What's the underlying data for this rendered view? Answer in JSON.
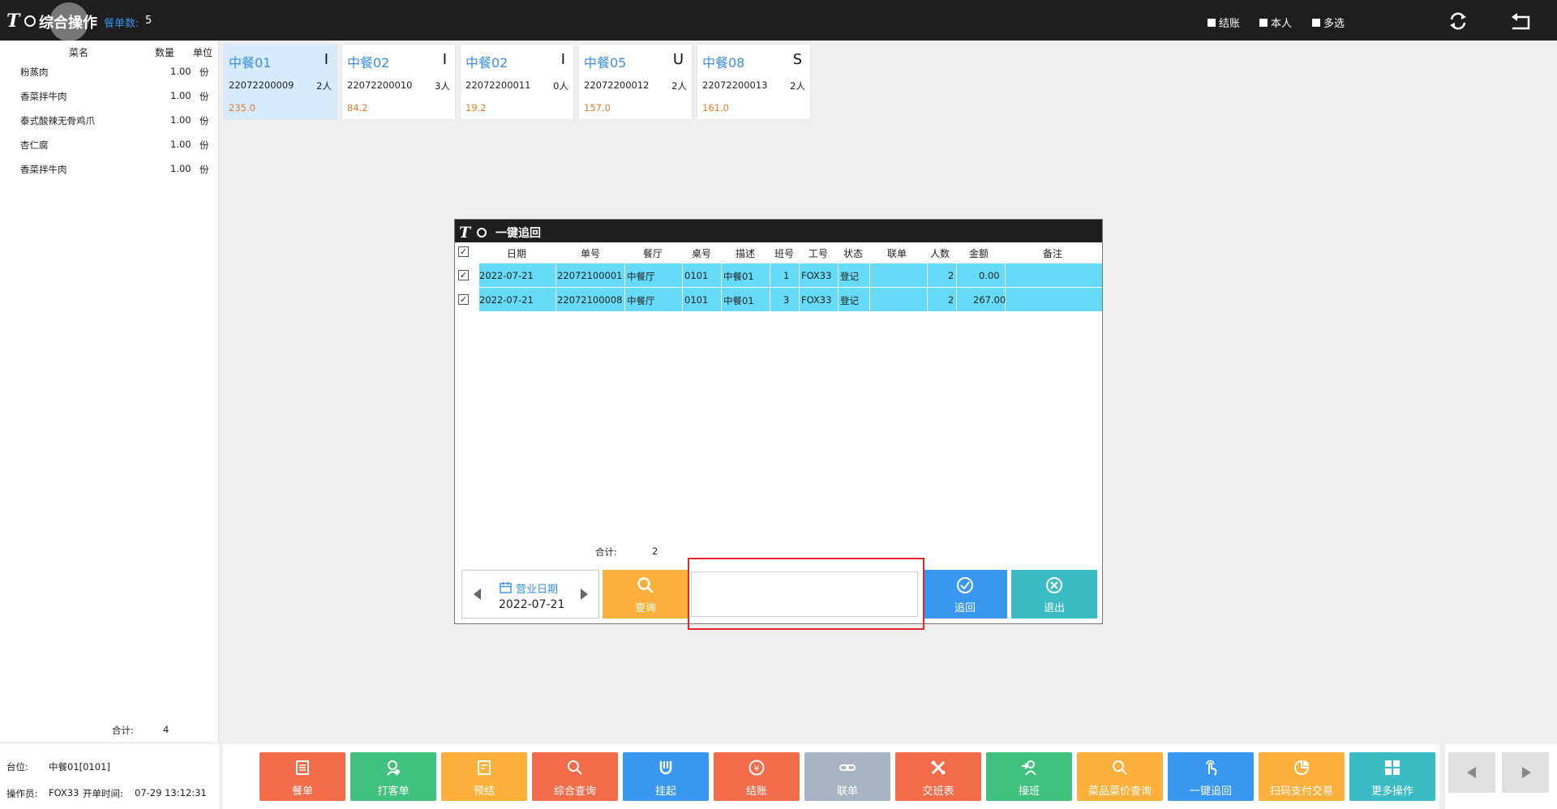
{
  "header": {
    "title": "综合操作",
    "order_count_label": "餐单数:",
    "order_count": "5",
    "options": [
      "结账",
      "本人",
      "多选"
    ]
  },
  "order_list": {
    "columns": [
      "菜名",
      "数量",
      "单位"
    ],
    "items": [
      {
        "name": "粉蒸肉",
        "qty": "1.00",
        "unit": "份"
      },
      {
        "name": "香菜拌牛肉",
        "qty": "1.00",
        "unit": "份"
      },
      {
        "name": "泰式酸辣无骨鸡爪",
        "qty": "1.00",
        "unit": "份"
      },
      {
        "name": "杏仁腐",
        "qty": "1.00",
        "unit": "份"
      },
      {
        "name": "香菜拌牛肉",
        "qty": "1.00",
        "unit": "份"
      }
    ],
    "total_label": "合计:",
    "total": "4"
  },
  "info": {
    "table_label": "台位:",
    "table_value": "中餐01[0101]",
    "operator_label": "操作员:",
    "operator_value": "FOX33",
    "open_time_label": "开单时间:",
    "open_time_value": "07-29 13:12:31"
  },
  "table_cards": [
    {
      "name": "中餐01",
      "status": "I",
      "order_no": "22072200009",
      "people": "2人",
      "amount": "235.0"
    },
    {
      "name": "中餐02",
      "status": "I",
      "order_no": "22072200010",
      "people": "3人",
      "amount": "84.2"
    },
    {
      "name": "中餐02",
      "status": "I",
      "order_no": "22072200011",
      "people": "0人",
      "amount": "19.2"
    },
    {
      "name": "中餐05",
      "status": "U",
      "order_no": "22072200012",
      "people": "2人",
      "amount": "157.0"
    },
    {
      "name": "中餐08",
      "status": "S",
      "order_no": "22072200013",
      "people": "2人",
      "amount": "161.0"
    }
  ],
  "dialog": {
    "title": "一键追回",
    "columns": [
      "日期",
      "单号",
      "餐厅",
      "桌号",
      "描述",
      "班号",
      "工号",
      "状态",
      "联单",
      "人数",
      "金额",
      "备注"
    ],
    "rows": [
      {
        "date": "2022-07-21",
        "no": "22072100001",
        "restaurant": "中餐厅",
        "table": "0101",
        "desc": "中餐01",
        "shift": "1",
        "staff": "FOX33",
        "status": "登记",
        "link": "",
        "people": "2",
        "amount": "0.00",
        "remark": ""
      },
      {
        "date": "2022-07-21",
        "no": "22072100008",
        "restaurant": "中餐厅",
        "table": "0101",
        "desc": "中餐01",
        "shift": "3",
        "staff": "FOX33",
        "status": "登记",
        "link": "",
        "people": "2",
        "amount": "267.00",
        "remark": ""
      }
    ],
    "sum_label": "合计:",
    "sum_value": "2",
    "date_label": "营业日期",
    "date_value": "2022-07-21",
    "query_label": "查询",
    "recall_label": "追回",
    "exit_label": "退出"
  },
  "toolbar": [
    {
      "label": "餐单",
      "icon": "list-icon",
      "color": "#f26b4a"
    },
    {
      "label": "打客单",
      "icon": "print-user-icon",
      "color": "#40c27e"
    },
    {
      "label": "预结",
      "icon": "note-icon",
      "color": "#fbb03b"
    },
    {
      "label": "综合查询",
      "icon": "search-icon",
      "color": "#f26b4a"
    },
    {
      "label": "挂起",
      "icon": "magnet-icon",
      "color": "#3a97f0"
    },
    {
      "label": "结账",
      "icon": "yen-icon",
      "color": "#f26b4a"
    },
    {
      "label": "联单",
      "icon": "link-icon",
      "color": "#a9b4c2"
    },
    {
      "label": "交班表",
      "icon": "tools-icon",
      "color": "#f26b4a"
    },
    {
      "label": "接班",
      "icon": "user-login-icon",
      "color": "#40c27e"
    },
    {
      "label": "菜品菜价查询",
      "icon": "search-icon",
      "color": "#fbb03b"
    },
    {
      "label": "一键追回",
      "icon": "touch-icon",
      "color": "#3a97f0"
    },
    {
      "label": "扫码支付交易",
      "icon": "pie-icon",
      "color": "#fbb03b"
    },
    {
      "label": "更多操作",
      "icon": "grid-icon",
      "color": "#3bbcc4"
    }
  ]
}
